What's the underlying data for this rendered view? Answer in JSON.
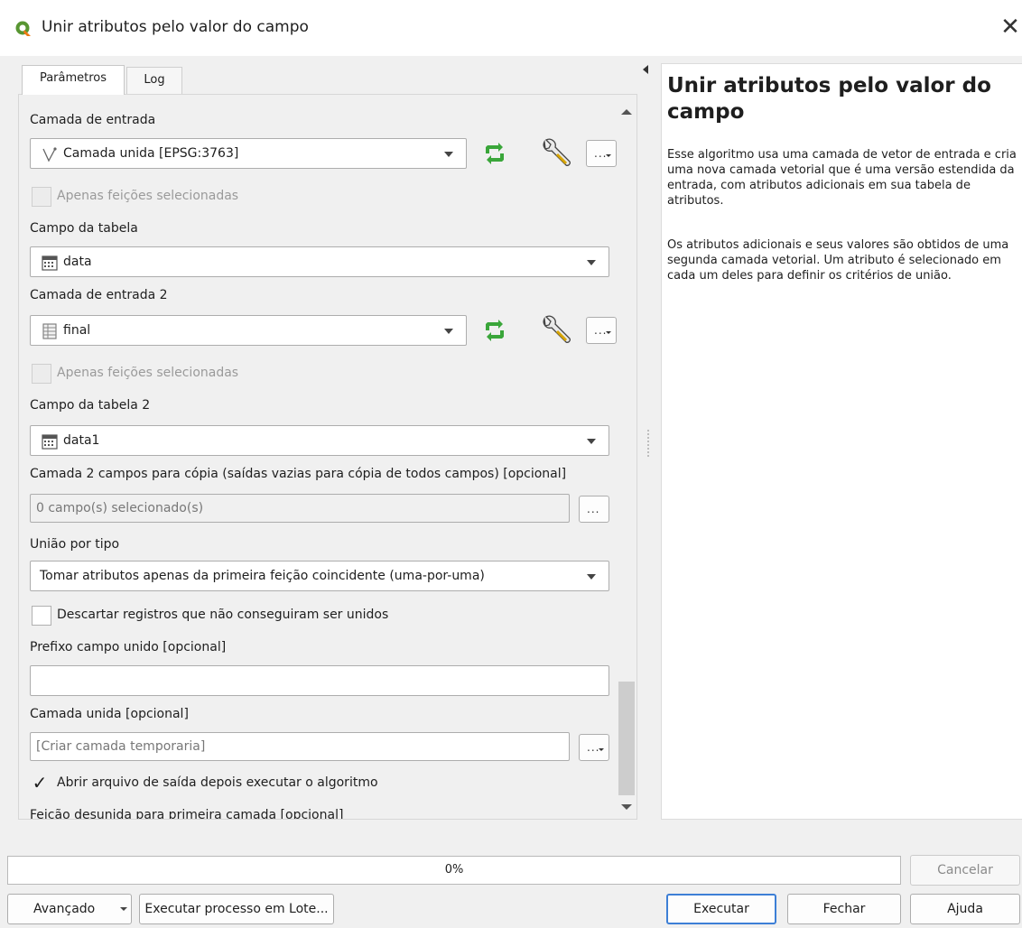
{
  "window": {
    "title": "Unir atributos pelo valor do campo",
    "close_glyph": "✕",
    "app_icon": "qgis-logo-icon"
  },
  "tabs": [
    {
      "label": "Parâmetros",
      "active": true
    },
    {
      "label": "Log",
      "active": false
    }
  ],
  "params": {
    "input_layer": {
      "label": "Camada de entrada",
      "value": "Camada unida [EPSG:3763]",
      "icon": "line-layer-icon"
    },
    "selected_only_1": {
      "label": "Apenas feições selecionadas",
      "checked": false,
      "enabled": false
    },
    "table_field": {
      "label": "Campo da tabela",
      "value": "data",
      "icon": "date-field-icon"
    },
    "input_layer_2": {
      "label": "Camada de entrada 2",
      "value": "final",
      "icon": "table-layer-icon"
    },
    "selected_only_2": {
      "label": "Apenas feições selecionadas",
      "checked": false,
      "enabled": false
    },
    "table_field_2": {
      "label": "Campo da tabela 2",
      "value": "data1",
      "icon": "date-field-icon"
    },
    "fields_to_copy": {
      "label": "Camada 2 campos para cópia (saídas vazias para cópia de todos campos) [opcional]",
      "value": "0 campo(s) selecionado(s)"
    },
    "join_type": {
      "label": "União por tipo",
      "value": "Tomar atributos apenas da primeira feição coincidente (uma-por-uma)"
    },
    "discard_nonmatching": {
      "label": "Descartar registros que não conseguiram ser unidos",
      "checked": false
    },
    "prefix": {
      "label": "Prefixo campo unido [opcional]",
      "value": ""
    },
    "joined_layer": {
      "label": "Camada unida [opcional]",
      "placeholder": "[Criar camada temporaria]"
    },
    "open_output": {
      "label": "Abrir arquivo de saída depois executar o algoritmo",
      "checked": true
    },
    "unjoinable_label": "Feição desunida para primeira camada [opcional]",
    "dots": "...",
    "check_glyph": "✓"
  },
  "help": {
    "title": "Unir atributos pelo valor do campo",
    "paragraphs": [
      "Esse algoritmo usa uma camada de vetor de entrada e cria uma nova camada vetorial que é uma versão estendida da entrada, com atributos adicionais em sua tabela de atributos.",
      "Os atributos adicionais e seus valores são obtidos de uma segunda camada vetorial. Um atributo é selecionado em cada um deles para definir os critérios de união."
    ]
  },
  "progress": {
    "percent": 0,
    "text": "0%"
  },
  "buttons": {
    "cancel": "Cancelar",
    "advanced": "Avançado",
    "batch": "Executar processo em Lote...",
    "run": "Executar",
    "close": "Fechar",
    "help": "Ajuda"
  },
  "colors": {
    "accent": "#3d7fd6",
    "iterate_green": "#3aa63a",
    "qgis_green": "#589632",
    "qgis_yellow": "#ee7913"
  }
}
